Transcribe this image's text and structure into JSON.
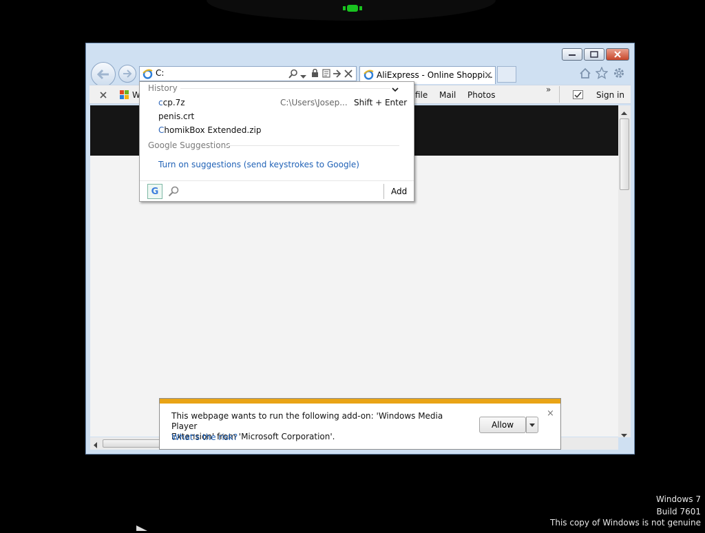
{
  "browser": {
    "address_value": "C:",
    "tabs": [
      {
        "label": "AliExpress - Online Shoppi..."
      }
    ],
    "toolbar": {
      "left_item": "W",
      "links": [
        "file",
        "Mail",
        "Photos"
      ],
      "more_glyph": "»",
      "sign_in": "Sign in"
    }
  },
  "dropdown": {
    "history_heading": "History",
    "history_items": [
      {
        "first": "c",
        "rest": "cp.7z",
        "path": "C:\\Users\\Josep...",
        "shortcut": "Shift + Enter"
      },
      {
        "first": "",
        "rest": "penis.crt",
        "path": "",
        "shortcut": ""
      },
      {
        "first": "C",
        "rest": "homikBox Extended.zip",
        "path": "",
        "shortcut": ""
      }
    ],
    "suggestions_heading": "Google Suggestions",
    "suggestions_link": "Turn on suggestions (send keystrokes to Google)",
    "search_provider_letter": "G",
    "add_label": "Add"
  },
  "notification": {
    "message_line1": "This webpage wants to run the following add-on: 'Windows Media Player",
    "message_line2": "Extension' from 'Microsoft Corporation'.",
    "risk_link": "What's the risk?",
    "allow_label": "Allow",
    "close_glyph": "×"
  },
  "watermark": {
    "line1": "Windows 7",
    "line2": "Build 7601",
    "line3": "This copy of Windows is not genuine"
  },
  "colors": {
    "frame": "#cfe0f2",
    "accent_link": "#1f61b6",
    "notify_bar": "#e9a416",
    "led_green": "#19c21f"
  }
}
